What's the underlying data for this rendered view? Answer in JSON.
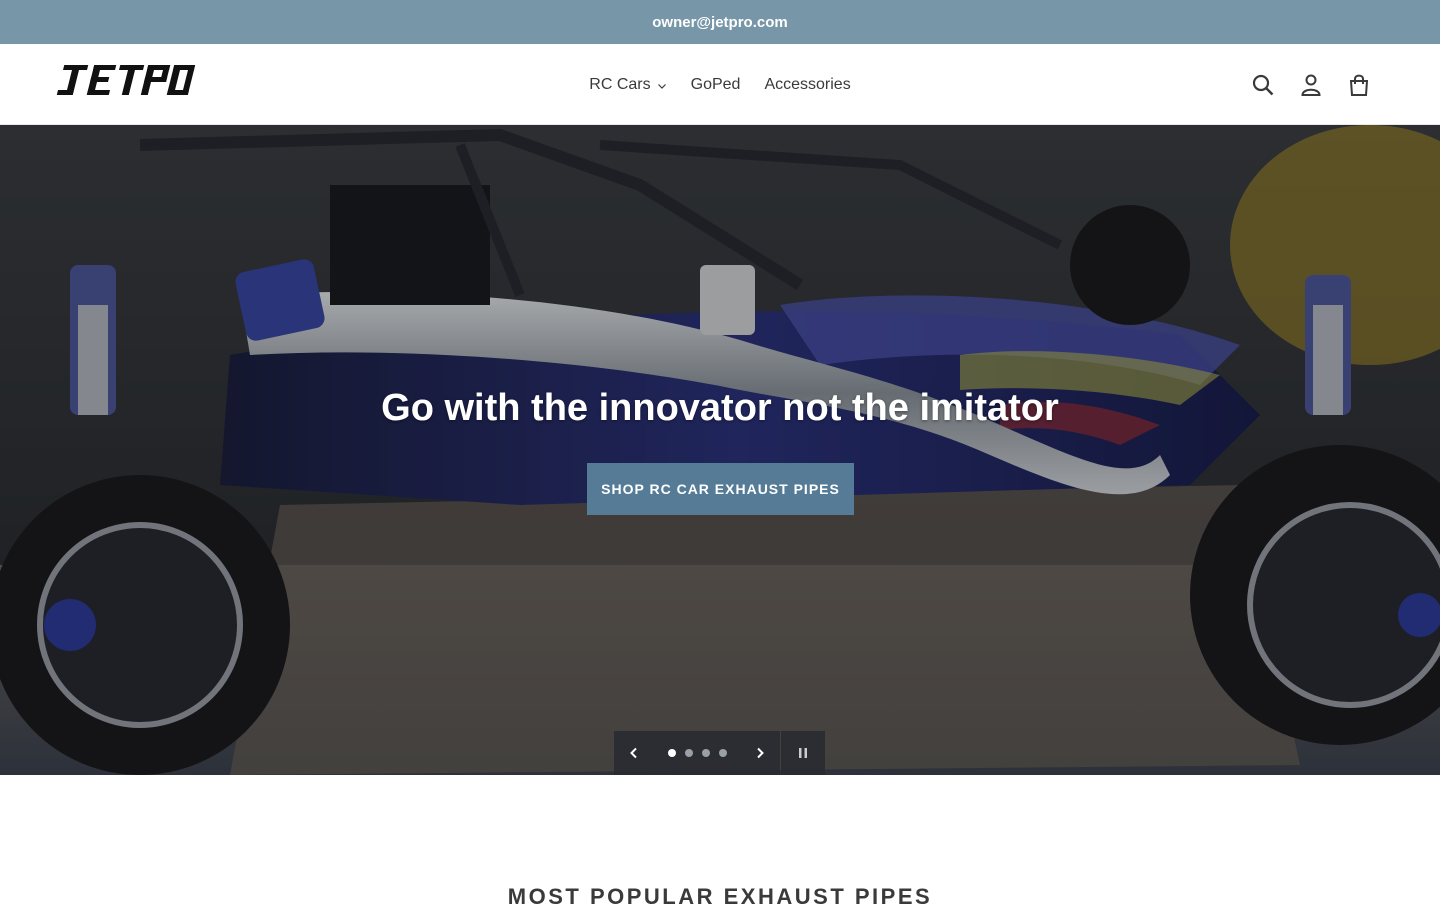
{
  "announcement": {
    "text": "owner@jetpro.com"
  },
  "header": {
    "logo_text": "JETPRO",
    "nav": [
      {
        "label": "RC Cars",
        "has_dropdown": true
      },
      {
        "label": "GoPed",
        "has_dropdown": false
      },
      {
        "label": "Accessories",
        "has_dropdown": false
      }
    ],
    "icons": [
      "search-icon",
      "account-icon",
      "cart-icon"
    ]
  },
  "hero": {
    "title": "Go with the innovator not the imitator",
    "button_label": "SHOP RC CAR EXHAUST PIPES",
    "slide_count": 4,
    "active_slide": 1
  },
  "section": {
    "title": "MOST POPULAR EXHAUST PIPES"
  },
  "colors": {
    "announcement_bg": "#7796a8",
    "button_bg": "#557b97",
    "text": "#3a3a3a"
  }
}
